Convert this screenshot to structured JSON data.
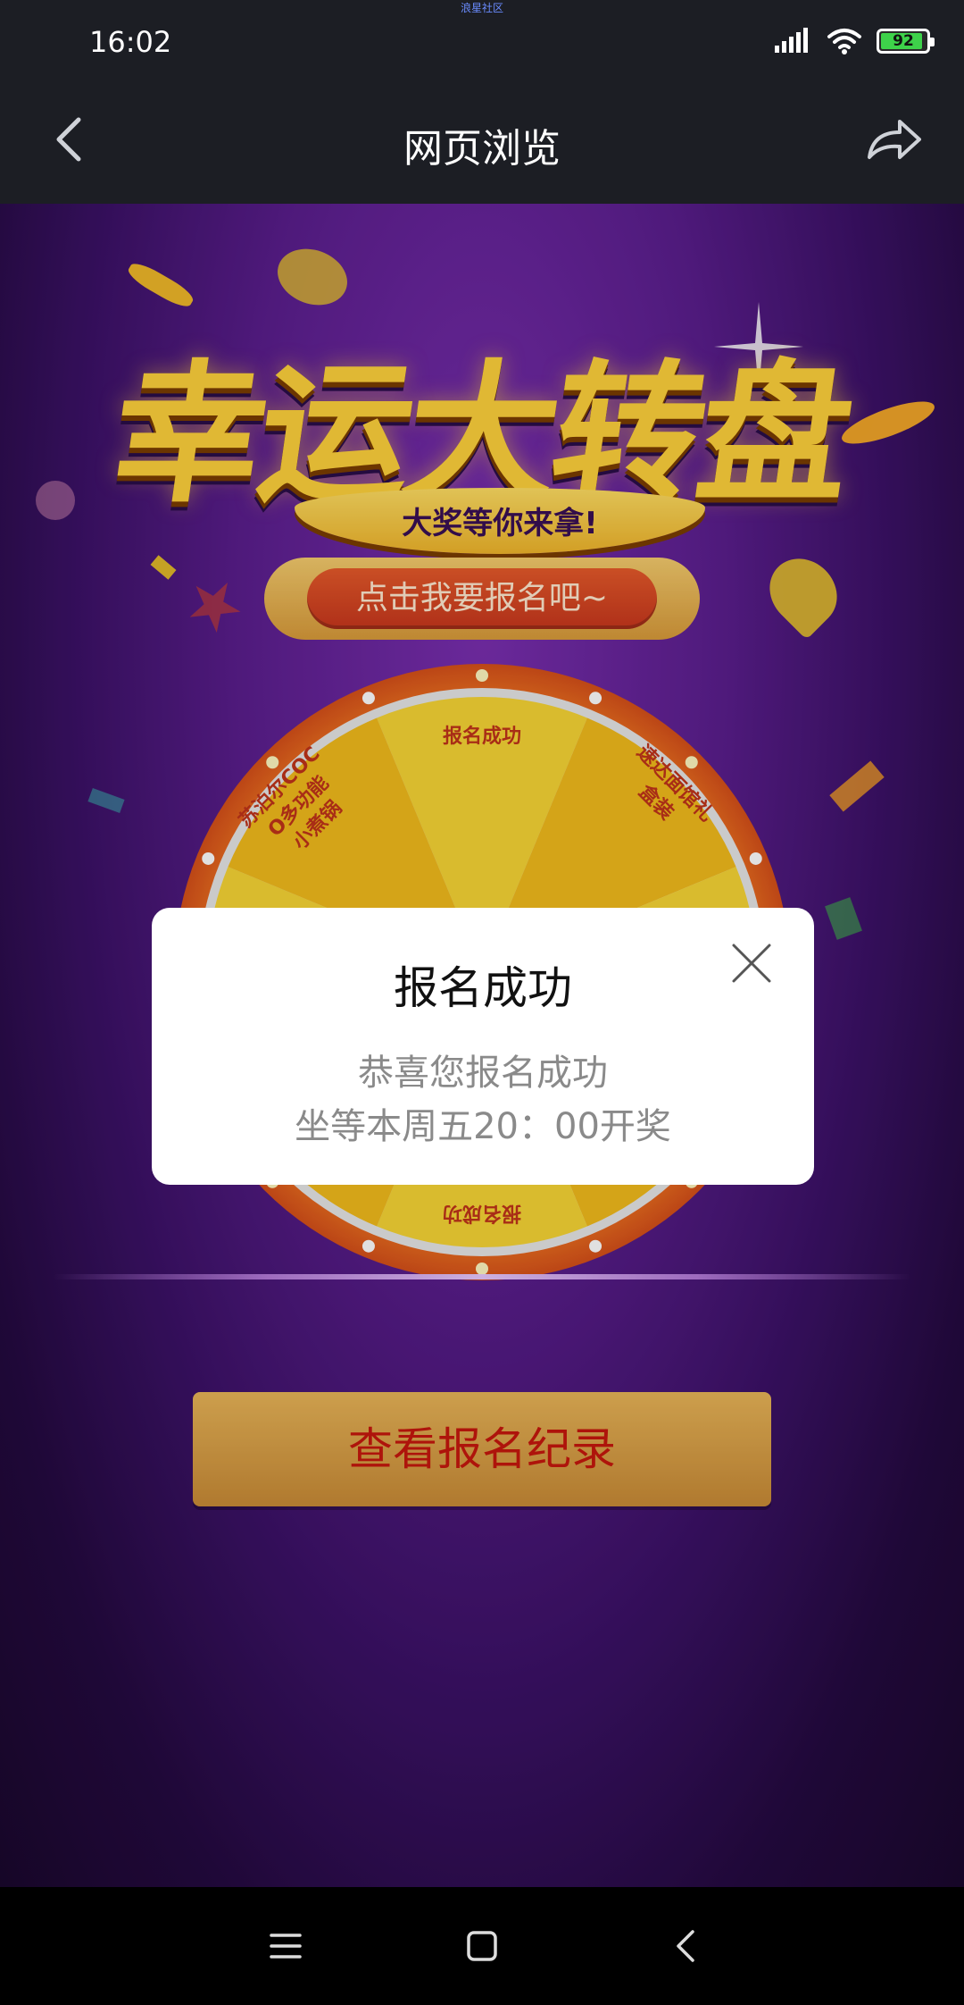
{
  "status_bar": {
    "carrier": "浪星社区",
    "time": "16:02",
    "battery": "92",
    "battery_level": 0.92,
    "icons": [
      "signal-icon",
      "wifi-icon",
      "battery-icon"
    ]
  },
  "nav": {
    "title": "网页浏览",
    "back_icon": "back-arrow-icon",
    "share_icon": "share-icon"
  },
  "hero": {
    "title": "幸运大转盘",
    "subtitle": "大奖等你来拿!"
  },
  "signup": {
    "label": "点击我要报名吧~"
  },
  "wheel": {
    "labels": {
      "top": "报名成功",
      "left": "苏泊尔COC\nO多功能\n小煮锅",
      "right": "速达面馆礼\n盒装",
      "bottom": "报名成功"
    }
  },
  "record_button": {
    "label": "查看报名纪录"
  },
  "dialog": {
    "title": "报名成功",
    "line1": "恭喜您报名成功",
    "line2": "坐等本周五20：00开奖",
    "close_icon": "close-icon"
  },
  "system_nav": {
    "icons": [
      "menu-icon",
      "home-icon",
      "back-icon"
    ]
  },
  "colors": {
    "accent_gold": "#ffd23c",
    "button_red": "#c8371d",
    "record_text": "#c6170d",
    "purple_bg": "#5b1e8e"
  }
}
